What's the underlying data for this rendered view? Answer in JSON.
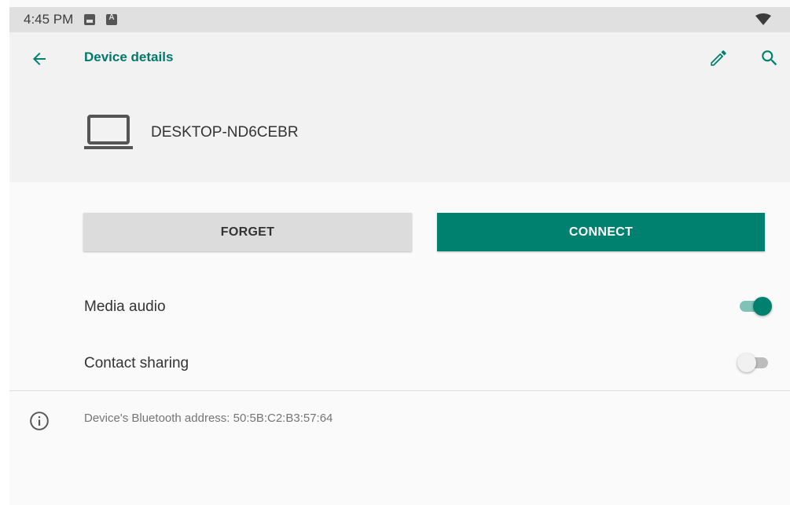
{
  "status_bar": {
    "time": "4:45 PM",
    "icons": [
      "image-notification-icon",
      "a-notification-icon",
      "wifi-icon"
    ]
  },
  "header": {
    "title": "Device details",
    "back_icon": "arrow-back-icon",
    "edit_icon": "pencil-icon",
    "search_icon": "search-icon"
  },
  "device": {
    "name": "DESKTOP-ND6CEBR",
    "icon": "laptop-icon"
  },
  "actions": {
    "forget_label": "FORGET",
    "connect_label": "CONNECT"
  },
  "settings": [
    {
      "label": "Media audio",
      "enabled": true
    },
    {
      "label": "Contact sharing",
      "enabled": false
    }
  ],
  "info": {
    "icon": "info-icon",
    "text": "Device's Bluetooth address: 50:5B:C2:B3:57:64"
  },
  "colors": {
    "accent": "#00806e",
    "title": "#00796b",
    "status_bar_bg": "#e0e0e0",
    "header_bg": "#f2f2f2",
    "page_bg": "#fafafa"
  }
}
